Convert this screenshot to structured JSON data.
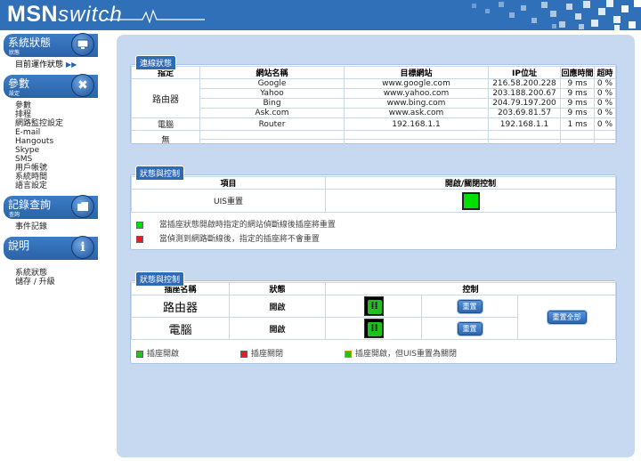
{
  "header": {
    "logo_main": "MSN",
    "logo_italic": "switch"
  },
  "sidebar": {
    "sections": [
      {
        "title": "系統狀態",
        "sub": "狀態",
        "icon": "monitor-icon",
        "items": [
          "目前運作狀態"
        ]
      },
      {
        "title": "參數",
        "sub": "設定",
        "icon": "tools-icon",
        "items": [
          "參數",
          "排程",
          "網路監控設定",
          "E-mail",
          "Hangouts",
          "Skype",
          "SMS",
          "用戶帳號",
          "系統時間",
          "語言設定"
        ]
      },
      {
        "title": "記錄查詢",
        "sub": "查詢",
        "icon": "folder-icon",
        "items": [
          "事件記錄"
        ]
      },
      {
        "title": "說明",
        "sub": "",
        "icon": "info-icon",
        "items": [
          "系統狀態",
          "儲存 / 升級"
        ]
      }
    ]
  },
  "connection": {
    "tab": "連線狀態",
    "headers": [
      "指定",
      "網站名稱",
      "目標網站",
      "IP位址",
      "回應時間",
      "超時"
    ],
    "groups": [
      {
        "label": "路由器",
        "rows": [
          [
            "Google",
            "www.google.com",
            "216.58.200.228",
            "9 ms",
            "0 %"
          ],
          [
            "Yahoo",
            "www.yahoo.com",
            "203.188.200.67",
            "9 ms",
            "0 %"
          ],
          [
            "Bing",
            "www.bing.com",
            "204.79.197.200",
            "9 ms",
            "0 %"
          ],
          [
            "Ask.com",
            "www.ask.com",
            "203.69.81.57",
            "9 ms",
            "0 %"
          ]
        ]
      },
      {
        "label": "電腦",
        "rows": [
          [
            "Router",
            "192.168.1.1",
            "192.168.1.1",
            "1 ms",
            "0 %"
          ]
        ]
      },
      {
        "label": "無",
        "rows": [
          [
            "",
            "",
            "",
            "",
            ""
          ],
          [
            "",
            "",
            "",
            "",
            ""
          ]
        ]
      }
    ]
  },
  "status_control": {
    "tab": "狀態與控制",
    "headers": [
      "項目",
      "開啟/關閉控制"
    ],
    "item": "UIS重置",
    "legend_on": "當插座狀態開啟時指定的網站偵斷線後插座將重置",
    "legend_off": "當偵測到網路斷線後，指定的插座將不會重置",
    "colors": {
      "on": "#00e000",
      "off": "#e02020"
    }
  },
  "outlet_control": {
    "tab": "狀態與控制",
    "headers": [
      "插座名稱",
      "狀態",
      "控制"
    ],
    "rows": [
      {
        "name": "路由器",
        "state": "開啟",
        "reset": "重置"
      },
      {
        "name": "電腦",
        "state": "開啟",
        "reset": "重置"
      }
    ],
    "reset_all": "重置全部",
    "legend": [
      "插座開啟",
      "插座關閉",
      "插座開啟，但UIS重置為關閉"
    ]
  }
}
